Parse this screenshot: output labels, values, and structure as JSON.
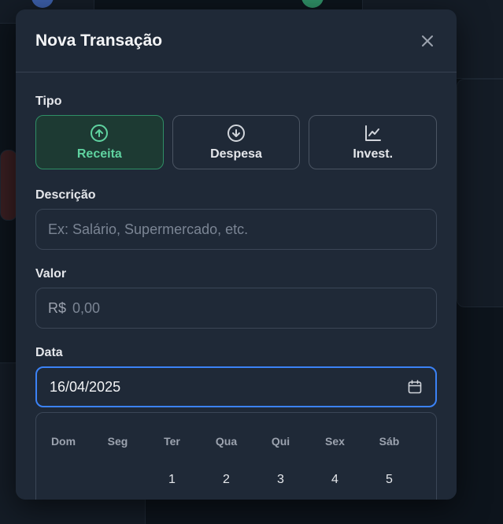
{
  "modal": {
    "title": "Nova Transação",
    "close_icon": "close-icon"
  },
  "tipo": {
    "label": "Tipo",
    "options": [
      {
        "label": "Receita",
        "icon": "arrow-up-circle-icon",
        "active": true
      },
      {
        "label": "Despesa",
        "icon": "arrow-down-circle-icon",
        "active": false
      },
      {
        "label": "Invest.",
        "icon": "line-chart-icon",
        "active": false
      }
    ]
  },
  "descricao": {
    "label": "Descrição",
    "placeholder": "Ex: Salário, Supermercado, etc."
  },
  "valor": {
    "label": "Valor",
    "currency": "R$",
    "placeholder": "0,00"
  },
  "data": {
    "label": "Data",
    "value": "16/04/2025",
    "icon": "calendar-icon"
  },
  "calendar": {
    "weekdays": [
      "Dom",
      "Seg",
      "Ter",
      "Qua",
      "Qui",
      "Sex",
      "Sáb"
    ],
    "first_week": [
      "",
      "",
      "1",
      "2",
      "3",
      "4",
      "5"
    ]
  },
  "colors": {
    "accent_green": "#5fd3a0",
    "focus_blue": "#3b82f6",
    "modal_bg": "#1f2937"
  }
}
